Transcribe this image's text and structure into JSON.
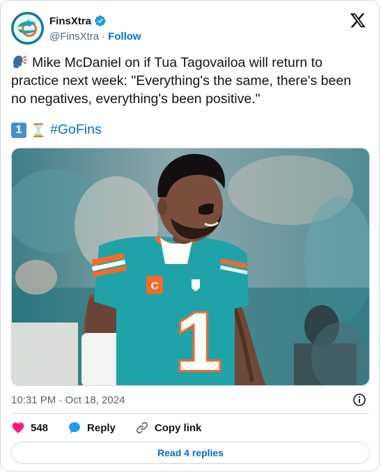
{
  "author": {
    "display_name": "FinsXtra",
    "handle": "@FinsXtra",
    "separator": "·",
    "follow_label": "Follow",
    "verified": true
  },
  "tweet": {
    "text": "Mike McDaniel on if Tua Tagovailoa will return to practice next week: \"Everything's the same, there's been no negatives, everything's been positive.\"",
    "leading_emoji": "speaking-head-icon",
    "keycap": "1",
    "hourglass": "hourglass-icon",
    "hashtag": "#GoFins",
    "timestamp": "10:31 PM · Oct 18, 2024"
  },
  "photo": {
    "jersey_number": "1",
    "captain_patch": "C"
  },
  "actions": {
    "likes": "548",
    "reply_label": "Reply",
    "copy_link_label": "Copy link",
    "read_replies_label": "Read 4 replies"
  },
  "colors": {
    "accent": "#006fd6",
    "like": "#f91880",
    "reply": "#1d9bf0",
    "muted": "#536471",
    "border": "#cfd9de",
    "jersey_aqua": "#1fa3a9",
    "jersey_orange": "#f26a2c"
  }
}
